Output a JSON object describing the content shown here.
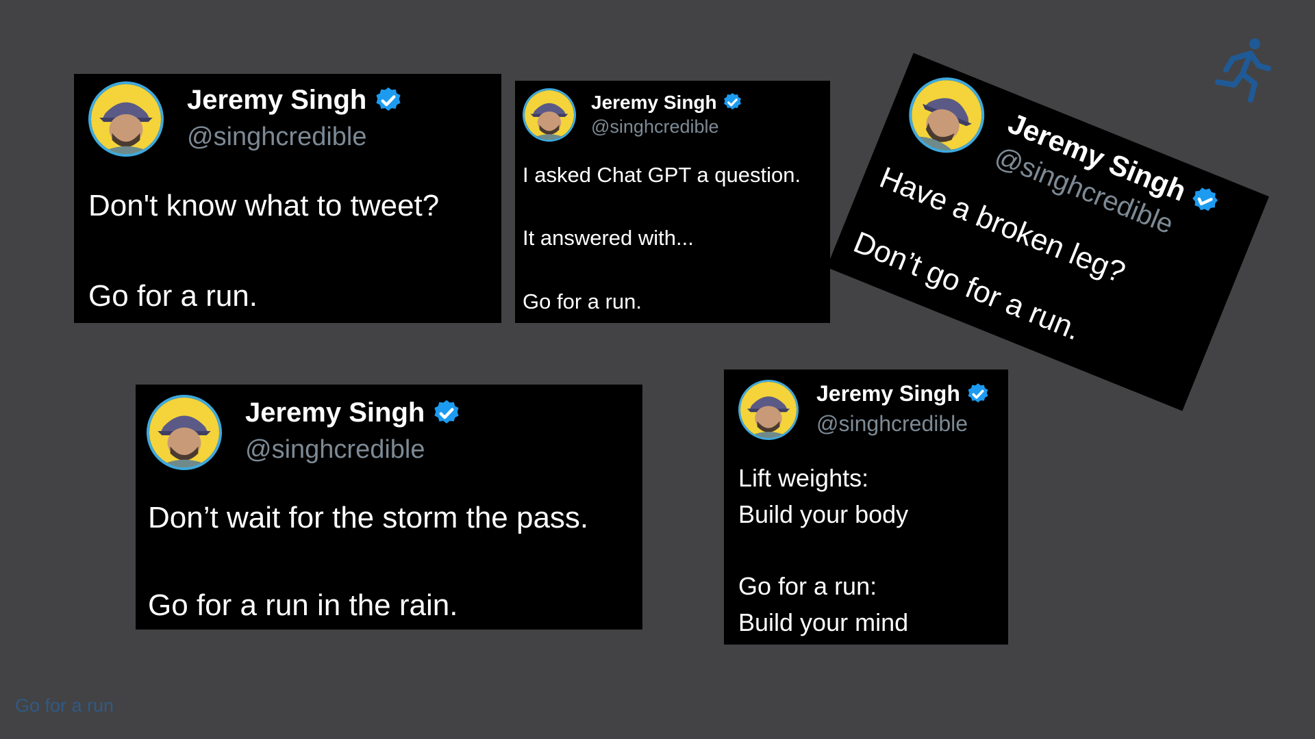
{
  "tweets": [
    {
      "name": "Jeremy Singh",
      "handle": "@singhcredible",
      "lines": [
        "Don't know what to tweet?",
        "Go for a run."
      ]
    },
    {
      "name": "Jeremy Singh",
      "handle": "@singhcredible",
      "lines": [
        "I asked Chat GPT a question.",
        "It answered with...",
        "Go for a run."
      ]
    },
    {
      "name": "Jeremy Singh",
      "handle": "@singhcredible",
      "lines": [
        "Have a broken leg?",
        "Don’t go for a run."
      ]
    },
    {
      "name": "Jeremy Singh",
      "handle": "@singhcredible",
      "lines": [
        "Don’t wait for the storm the pass.",
        "Go for a run in the rain."
      ]
    },
    {
      "name": "Jeremy Singh",
      "handle": "@singhcredible",
      "lines": [
        "Lift weights:",
        "Build your body",
        "Go for a run:",
        "Build your mind"
      ]
    }
  ],
  "footer": {
    "label": "Go for a run"
  },
  "icons": {
    "corner": "running-person-icon",
    "badge": "verified-badge-icon",
    "avatar": "avatar-cap-portrait"
  },
  "colors": {
    "background": "#434345",
    "card": "#000000",
    "text": "#ffffff",
    "handle": "#7d8a95",
    "verified": "#1d9bf0",
    "avatar_ring": "#3fa9dd",
    "runner": "#1f5a97",
    "footer": "#2f5a86"
  }
}
